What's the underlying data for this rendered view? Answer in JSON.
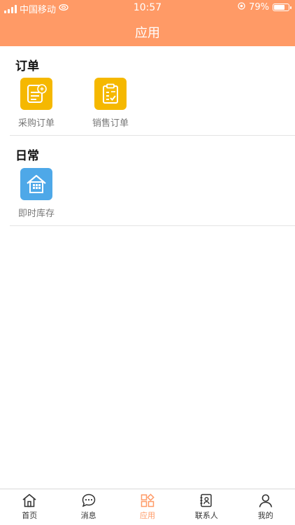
{
  "status": {
    "carrier": "中国移动",
    "time": "10:57",
    "battery": "79%",
    "battery_level": 0.79
  },
  "header": {
    "title": "应用"
  },
  "sections": [
    {
      "title": "订单",
      "items": [
        {
          "label": "采购订单",
          "icon": "purchase-order-icon",
          "color": "#f5b800"
        },
        {
          "label": "销售订单",
          "icon": "sales-order-icon",
          "color": "#f5b800"
        }
      ]
    },
    {
      "title": "日常",
      "items": [
        {
          "label": "即时库存",
          "icon": "warehouse-icon",
          "color": "#4ea8e8"
        }
      ]
    }
  ],
  "tabbar": {
    "active": 2,
    "accent": "#ff9a66",
    "items": [
      {
        "label": "首页",
        "icon": "home-icon"
      },
      {
        "label": "消息",
        "icon": "message-icon"
      },
      {
        "label": "应用",
        "icon": "apps-icon"
      },
      {
        "label": "联系人",
        "icon": "contacts-icon"
      },
      {
        "label": "我的",
        "icon": "profile-icon"
      }
    ]
  }
}
